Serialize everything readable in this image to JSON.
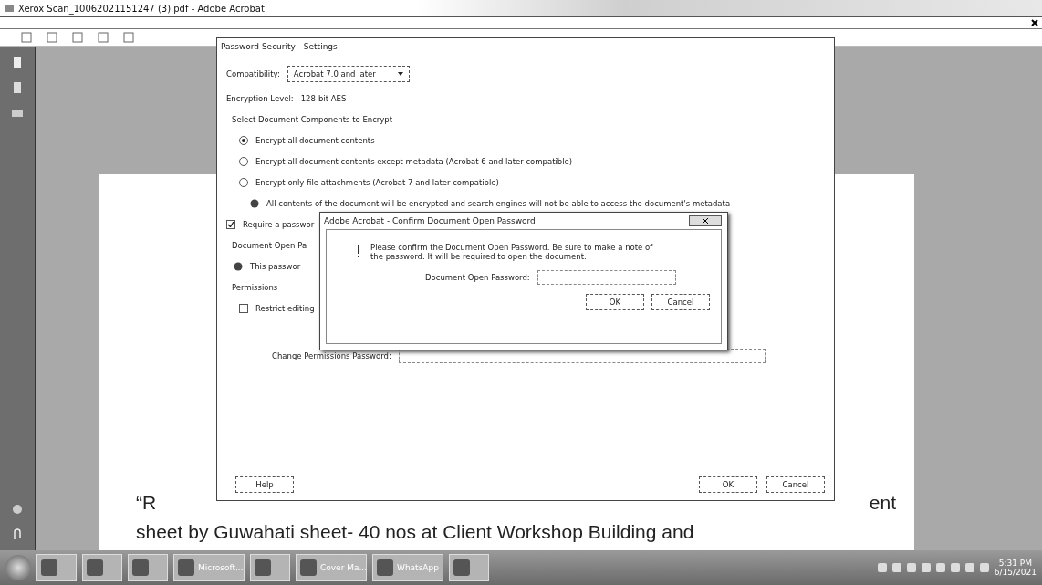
{
  "window": {
    "title": "Xerox Scan_10062021151247 (3).pdf - Adobe Acrobat"
  },
  "document": {
    "lines": [
      "“R",
      "ent",
      "sheet by Guwahati sheet- 40 nos at Client Workshop Building and"
    ]
  },
  "settings_dialog": {
    "title": "Password Security - Settings",
    "compatibility_label": "Compatibility:",
    "compatibility_value": "Acrobat 7.0 and later",
    "encryption_label": "Encryption Level:",
    "encryption_value": "128-bit AES",
    "components_heading": "Select Document Components to Encrypt",
    "options": [
      {
        "label": "Encrypt all document contents",
        "selected": true
      },
      {
        "label": "Encrypt all document contents except metadata (Acrobat 6 and later compatible)",
        "selected": false
      },
      {
        "label": "Encrypt only file attachments (Acrobat 7 and later compatible)",
        "selected": false
      }
    ],
    "info": "All contents of the document will be encrypted and search engines will not be able to access the document's metadata",
    "require_password": {
      "label": "Require a passwor",
      "checked": true
    },
    "open_password_label": "Document Open Pa",
    "password_info": "This passwor",
    "permissions_heading": "Permissions",
    "restrict_editing": {
      "label": "Restrict editing",
      "checked": false
    },
    "change_permissions_label": "Change Permissions Password:",
    "buttons": [
      "Help",
      "OK",
      "Cancel"
    ]
  },
  "confirm_dialog": {
    "title": "Adobe Acrobat - Confirm Document Open Password",
    "message": "Please confirm the Document Open Password. Be sure to make a note of the password. It will be required to open the document.",
    "field_label": "Document Open Password:",
    "buttons": [
      "OK",
      "Cancel"
    ]
  },
  "taskbar": {
    "items": [
      {
        "kind": "icon"
      },
      {
        "kind": "icon"
      },
      {
        "kind": "icon"
      },
      {
        "kind": "labeled",
        "label": "Microsoft..."
      },
      {
        "kind": "icon"
      },
      {
        "kind": "labeled",
        "label": "Cover Ma..."
      },
      {
        "kind": "labeled",
        "label": "WhatsApp"
      },
      {
        "kind": "icon"
      }
    ],
    "time": "5:31 PM",
    "date": "6/15/2021"
  }
}
